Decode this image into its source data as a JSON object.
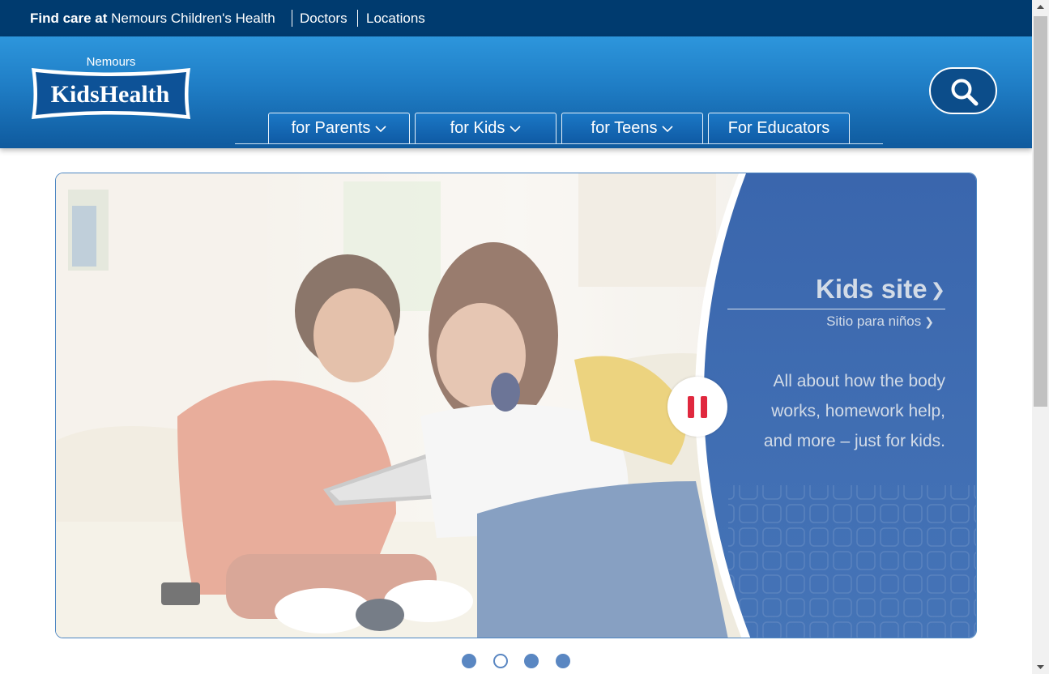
{
  "topbar": {
    "find_bold": "Find care at",
    "find_link": "Nemours Children's Health",
    "doctors": "Doctors",
    "locations": "Locations"
  },
  "header": {
    "logo_top": "Nemours",
    "logo_main": "KidsHealth",
    "nav": [
      {
        "label": "for Parents",
        "has_dropdown": true
      },
      {
        "label": "for Kids",
        "has_dropdown": true
      },
      {
        "label": "for Teens",
        "has_dropdown": true
      },
      {
        "label": "For Educators",
        "has_dropdown": false
      }
    ],
    "search_icon": "search-icon"
  },
  "hero": {
    "title": "Kids site",
    "subtitle": "Sitio para niños",
    "blurb_lines": [
      "All about how the body",
      "works, homework help,",
      "and more – just for kids."
    ],
    "pause_icon": "pause-icon"
  },
  "carousel": {
    "dots": [
      {
        "active": false
      },
      {
        "active": true
      },
      {
        "active": false
      },
      {
        "active": false
      }
    ]
  },
  "colors": {
    "topbar_bg": "#003b6f",
    "header_bg": "#1f7dc5",
    "panel_bg": "#3d6cb0",
    "pause_red": "#e0283e"
  }
}
